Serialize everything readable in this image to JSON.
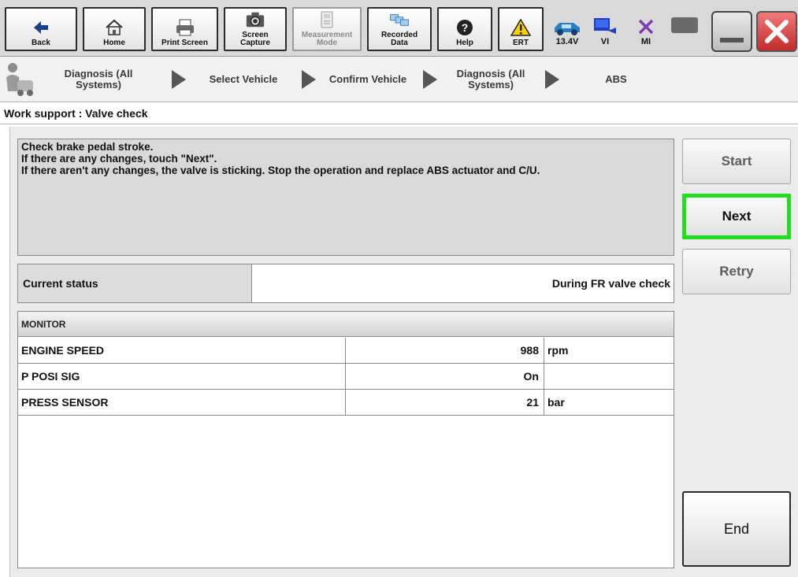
{
  "toolbar": {
    "buttons": [
      {
        "label": "Back",
        "icon": "back-arrow-icon"
      },
      {
        "label": "Home",
        "icon": "home-icon"
      },
      {
        "label": "Print Screen",
        "icon": "printer-icon"
      },
      {
        "label": "Screen Capture",
        "icon": "camera-icon"
      },
      {
        "label": "Measurement Mode",
        "icon": "measurement-icon"
      },
      {
        "label": "Recorded Data",
        "icon": "recorded-data-icon"
      },
      {
        "label": "Help",
        "icon": "help-icon"
      },
      {
        "label": "ERT",
        "icon": "warning-icon"
      }
    ],
    "status": [
      {
        "label": "13.4V",
        "icon": "car-battery-icon"
      },
      {
        "label": "VI",
        "icon": "vehicle-interface-icon"
      },
      {
        "label": "MI",
        "icon": "mi-cross-icon"
      }
    ]
  },
  "breadcrumb": {
    "items": [
      "Diagnosis (All Systems)",
      "Select Vehicle",
      "Confirm Vehicle",
      "Diagnosis (All Systems)",
      "ABS"
    ]
  },
  "page": {
    "title": "Work support : Valve check"
  },
  "message": {
    "line1": "Check brake pedal stroke.",
    "line2": "If there are any changes, touch \"Next\".",
    "line3": "If there aren't any changes, the valve is  sticking. Stop the operation and replace ABS actuator and C/U."
  },
  "status": {
    "label": "Current status",
    "value": "During FR valve check"
  },
  "monitor": {
    "header": "MONITOR",
    "rows": [
      {
        "name": "ENGINE SPEED",
        "value": "988",
        "unit": "rpm"
      },
      {
        "name": "P POSI SIG",
        "value": "On",
        "unit": ""
      },
      {
        "name": "PRESS SENSOR",
        "value": "21",
        "unit": "bar"
      }
    ]
  },
  "actions": {
    "start": "Start",
    "next": "Next",
    "retry": "Retry",
    "end": "End"
  },
  "colors": {
    "highlight": "#22dd22",
    "close": "#e03a3a",
    "toolbar_bg": "#d9d9d9",
    "content_bg": "#ebebeb"
  }
}
